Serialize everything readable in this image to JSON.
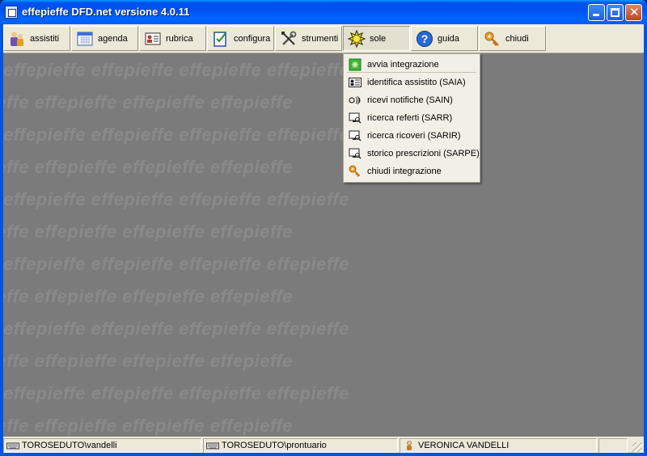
{
  "window": {
    "title": "effepieffe DFD.net versione 4.0.11"
  },
  "toolbar": [
    {
      "id": "assistiti",
      "label": "assistiti",
      "icon": "patient-icon"
    },
    {
      "id": "agenda",
      "label": "agenda",
      "icon": "calendar-icon"
    },
    {
      "id": "rubrica",
      "label": "rubrica",
      "icon": "address-card-icon"
    },
    {
      "id": "configura",
      "label": "configura",
      "icon": "checklist-icon"
    },
    {
      "id": "strumenti",
      "label": "strumenti",
      "icon": "tools-icon"
    },
    {
      "id": "sole",
      "label": "sole",
      "icon": "sun-icon"
    },
    {
      "id": "guida",
      "label": "guida",
      "icon": "help-icon"
    },
    {
      "id": "chiudi",
      "label": "chiudi",
      "icon": "key-icon"
    }
  ],
  "watermark": "effepieffe effepieffe effepieffe effepieffe",
  "menu": {
    "items": [
      {
        "label": "avvia integrazione",
        "icon": "start-icon"
      },
      {
        "label": "identifica assistito (SAIA)",
        "icon": "id-card-icon"
      },
      {
        "label": "ricevi notifiche (SAIN)",
        "icon": "signal-icon"
      },
      {
        "label": "ricerca referti (SARR)",
        "icon": "monitor-search-icon"
      },
      {
        "label": "ricerca ricoveri (SARIR)",
        "icon": "monitor-search-icon"
      },
      {
        "label": "storico prescrizioni (SARPE)",
        "icon": "monitor-search-icon"
      },
      {
        "label": "chiudi integrazione",
        "icon": "key-icon"
      }
    ]
  },
  "statusbar": {
    "panel1": "TOROSEDUTO\\vandelli",
    "panel2": "TOROSEDUTO\\prontuario",
    "panel3": "VERONICA VANDELLI"
  }
}
